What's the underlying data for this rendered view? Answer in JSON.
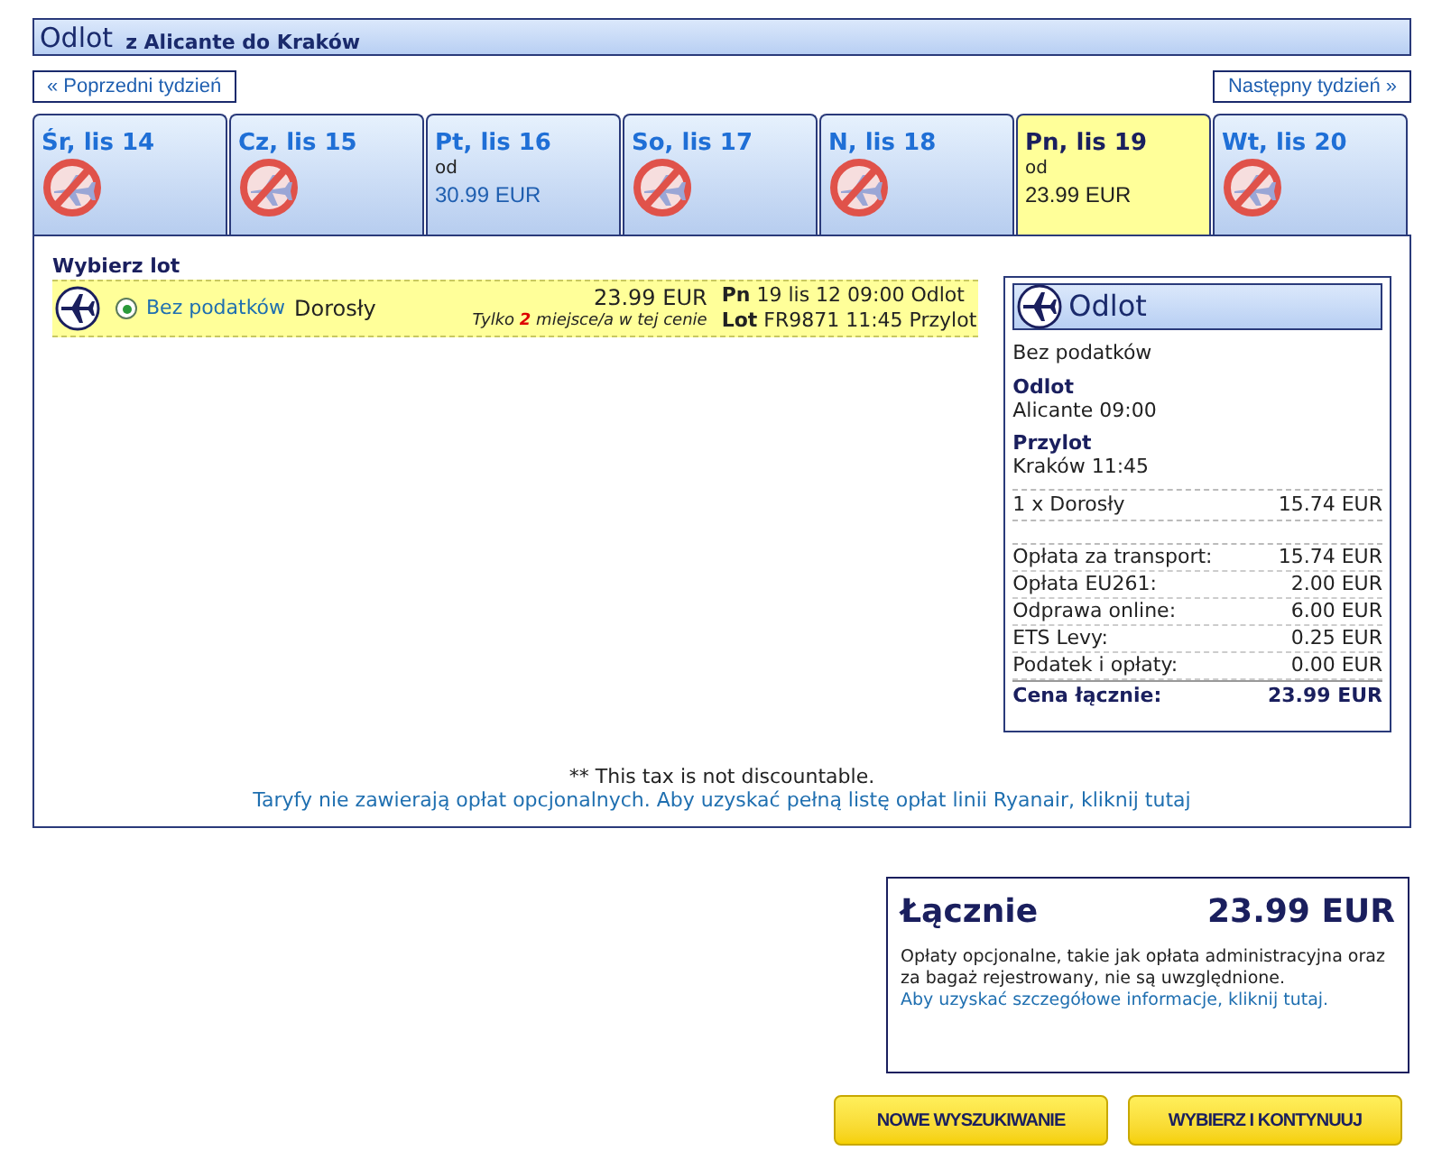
{
  "header": {
    "title": "Odlot",
    "route": "z Alicante do Kraków"
  },
  "nav": {
    "prev": "« Poprzedni tydzień",
    "next": "Następny tydzień »"
  },
  "days": [
    {
      "label": "Śr, lis 14",
      "kind": "no_flight",
      "selected": false
    },
    {
      "label": "Cz, lis 15",
      "kind": "no_flight",
      "selected": false
    },
    {
      "label": "Pt, lis 16",
      "kind": "fare",
      "from": "od",
      "price": "30.99 EUR",
      "selected": false
    },
    {
      "label": "So, lis 17",
      "kind": "no_flight",
      "selected": false
    },
    {
      "label": "N, lis 18",
      "kind": "no_flight",
      "selected": false
    },
    {
      "label": "Pn, lis 19",
      "kind": "fare",
      "from": "od",
      "price": "23.99 EUR",
      "selected": true
    },
    {
      "label": "Wt, lis 20",
      "kind": "no_flight",
      "selected": false
    }
  ],
  "flights": {
    "heading": "Wybierz lot",
    "rows": [
      {
        "selected": true,
        "fare": "Bez podatków",
        "passenger": "Dorosły",
        "price": "23.99 EUR",
        "note": "Tylko **2** miejsce/a w tej cenie",
        "line1": "**Pn** 19 lis 12 09:00 Odlot",
        "line2": "**Lot** FR9871 11:45 Przylot"
      }
    ]
  },
  "summary": {
    "title": "Odlot",
    "fare": "Bez podatków",
    "departure_label": "Odlot",
    "departure": "Alicante 09:00",
    "arrival_label": "Przylot",
    "arrival": "Kraków 11:45",
    "passengers": [
      {
        "label": "1 x Dorosły",
        "value": "15.74 EUR"
      }
    ],
    "breakdown": [
      {
        "label": "Opłata za transport:",
        "value": "15.74 EUR"
      },
      {
        "label": "Opłata EU261:",
        "value": "2.00 EUR"
      },
      {
        "label": "Odprawa online:",
        "value": "6.00 EUR"
      },
      {
        "label": "ETS Levy:",
        "value": "0.25 EUR"
      },
      {
        "label": "Podatek i opłaty:",
        "value": "0.00 EUR"
      }
    ],
    "total_label": "Cena łącznie:",
    "total": "23.99 EUR"
  },
  "footnote": "** This tax is not discountable.",
  "fees_link": "Taryfy nie zawierają opłat opcjonalnych. Aby uzyskać pełną listę opłat linii Ryanair, kliknij tutaj",
  "total_box": {
    "label": "Łącznie",
    "value": "23.99 EUR",
    "text": "Opłaty opcjonalne, takie jak opłata administracyjna oraz za bagaż rejestrowany, nie są uwzględnione.",
    "link": "Aby uzyskać szczegółowe informacje, kliknij tutaj."
  },
  "buttons": [
    "NOWE WYSZUKIWANIE",
    "WYBIERZ I KONTYNUUJ"
  ]
}
